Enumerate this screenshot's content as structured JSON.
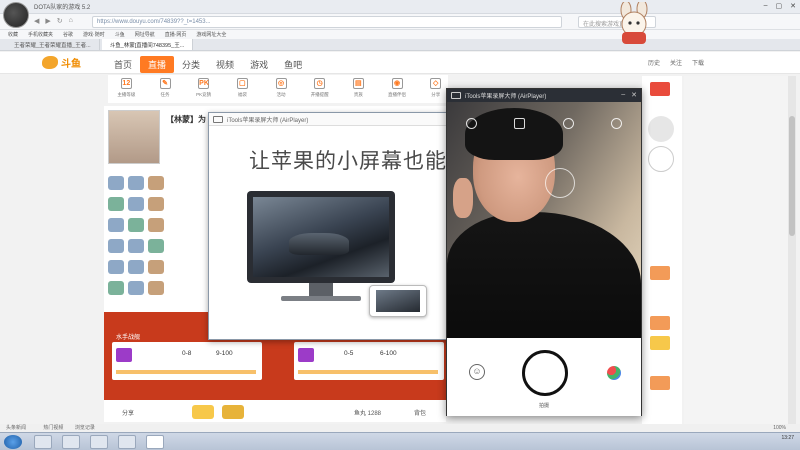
{
  "browser": {
    "window_title": "DOTA队家的游戏 5.2",
    "url": "https://www.douyu.com/74839??_t=1453...",
    "search_placeholder": "在此搜索游戏直播",
    "bookmarks": [
      "收藏",
      "手机收藏夹",
      "谷歌",
      "游戏·随时",
      "斗鱼",
      "网址导航",
      "直播·网页",
      "游戏网址大全"
    ],
    "tabs": [
      {
        "label": "王者荣耀_王者荣耀直播_王者...",
        "active": false
      },
      {
        "label": "斗鱼_林蒙[直播间748395_王...",
        "active": true
      }
    ]
  },
  "site": {
    "logo": "斗鱼",
    "nav": [
      {
        "label": "首页",
        "active": false
      },
      {
        "label": "直播",
        "active": true
      },
      {
        "label": "分类",
        "active": false
      },
      {
        "label": "视频",
        "active": false
      },
      {
        "label": "游戏",
        "active": false
      },
      {
        "label": "鱼吧",
        "active": false
      }
    ],
    "nav_right": [
      "历史",
      "关注",
      "下载"
    ],
    "toolbar": [
      {
        "icon": "12",
        "label": "主播等级"
      },
      {
        "icon": "✎",
        "label": "任务"
      },
      {
        "icon": "PK",
        "label": "PK竞猜"
      },
      {
        "icon": "▢",
        "label": "福袋"
      },
      {
        "icon": "◎",
        "label": "活动"
      },
      {
        "icon": "◷",
        "label": "开播提醒"
      },
      {
        "icon": "▤",
        "label": "贵族"
      },
      {
        "icon": "◉",
        "label": "直播伴侣"
      },
      {
        "icon": "◇",
        "label": "分享"
      }
    ],
    "streamer_name": "【林蒙】为",
    "promo_cards": [
      {
        "tag": "水手战舰",
        "left_score": "0-8",
        "right_score": "9-100"
      },
      {
        "tag": "",
        "left_score": "0-5",
        "right_score": "6-100"
      }
    ],
    "bottom": {
      "share": "分享",
      "fans": "鱼丸 1288",
      "gift_count": "背包"
    }
  },
  "airplayer_main": {
    "title": "iTools苹果录屏大师 (AirPlayer)",
    "slogan": "让苹果的小屏幕也能"
  },
  "airplayer_cam": {
    "title": "iTools苹果录屏大师 (AirPlayer)",
    "shutter_label": "拍摄"
  },
  "status": {
    "left": "头条新闻",
    "items": [
      "热门视频",
      "浏览记录"
    ],
    "zoom": "100%"
  },
  "taskbar": {
    "time": "13:27"
  }
}
